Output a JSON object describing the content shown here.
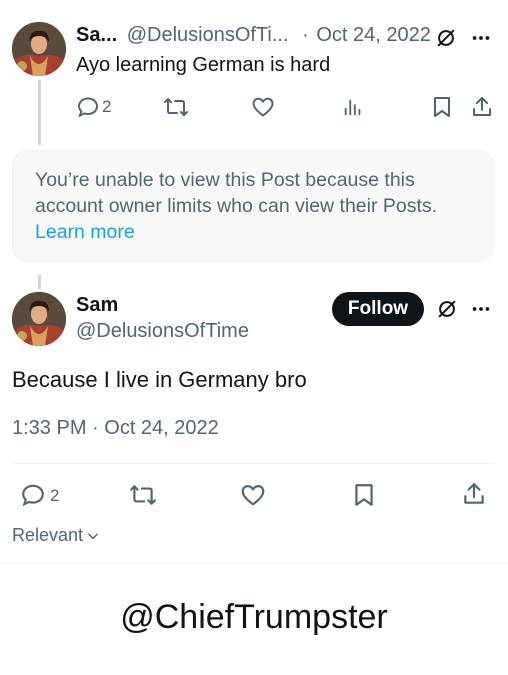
{
  "top_post": {
    "name": "Sa...",
    "handle": "@DelusionsOfTi...",
    "separator": "·",
    "date": "Oct 24, 2022",
    "text": "Ayo learning German is hard",
    "reply_count": "2",
    "more_icon": "more-icon",
    "grok_icon": "grok-icon"
  },
  "unavailable_card": {
    "message": "You’re unable to view this Post because this account owner limits who can view their Posts.",
    "learn_more": "Learn more"
  },
  "main_post": {
    "name": "Sam",
    "handle": "@DelusionsOfTime",
    "follow_label": "Follow",
    "text": "Because I live in Germany bro",
    "timestamp": "1:33 PM · Oct 24, 2022",
    "reply_count": "2"
  },
  "sort": {
    "label": "Relevant"
  },
  "watermark": "@ChiefTrumpster",
  "colors": {
    "text": "#0f1419",
    "muted": "#536471",
    "link": "#1d9bf0",
    "card_bg": "#f7f9f9",
    "line": "#cfd9de"
  }
}
